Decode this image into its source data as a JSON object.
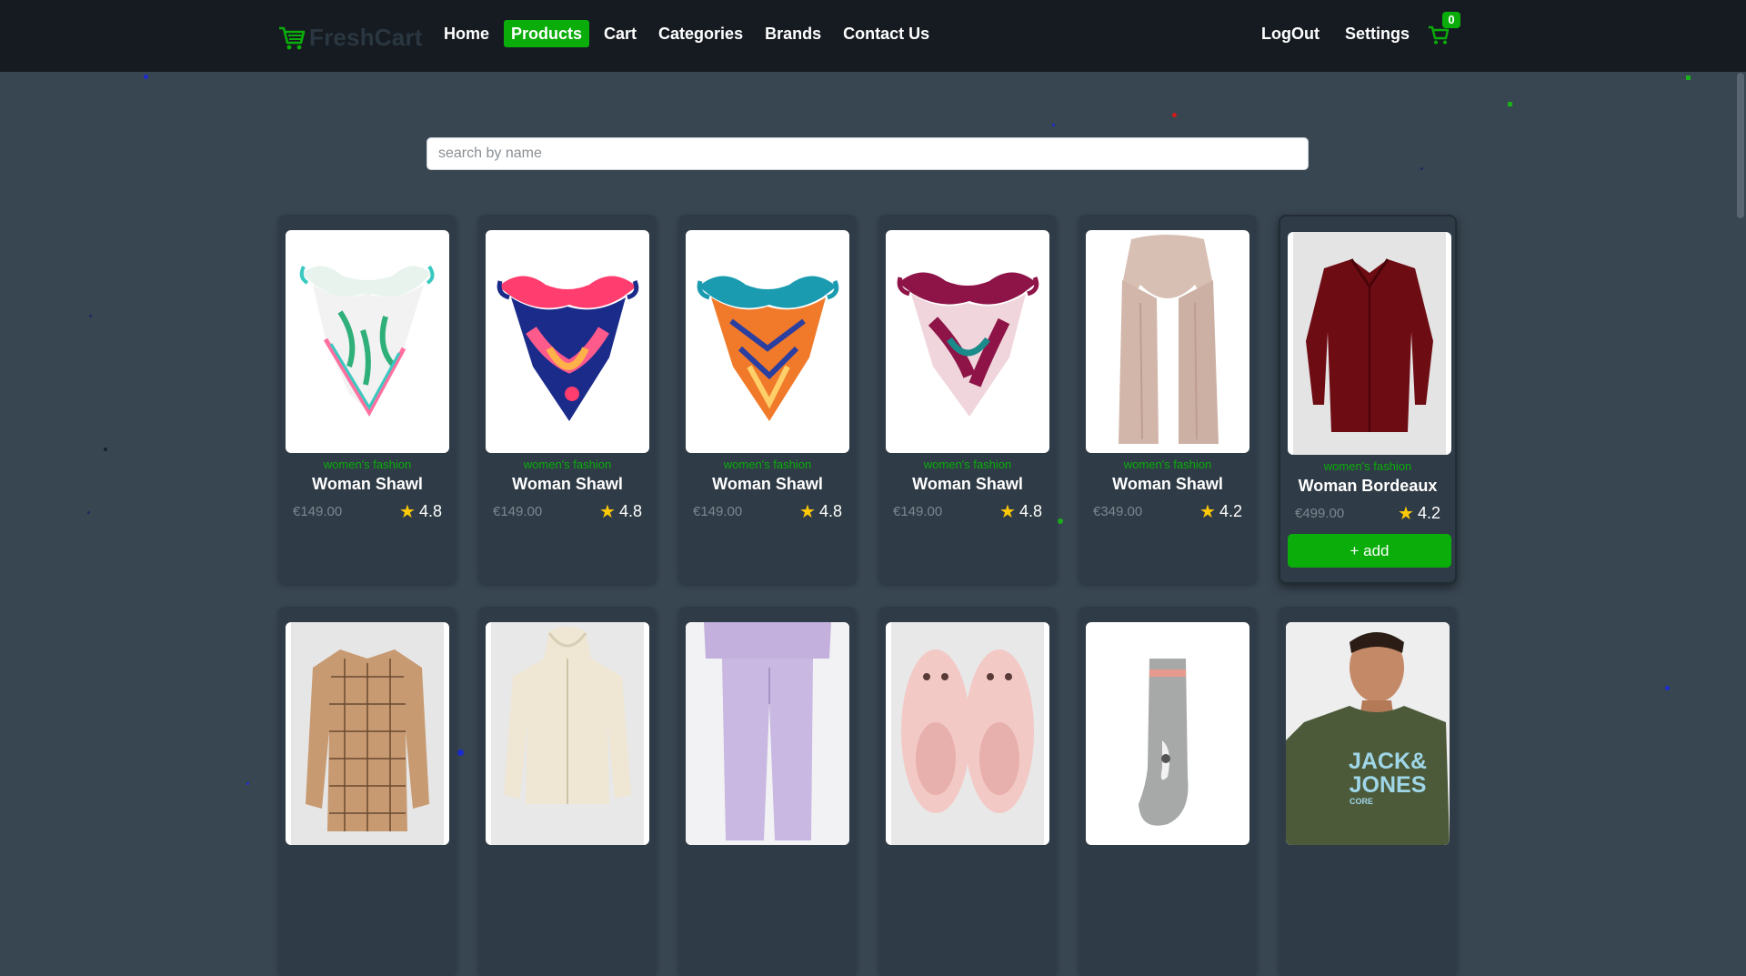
{
  "brand": {
    "name": "FreshCart",
    "icon": "cart-icon"
  },
  "nav": {
    "links": [
      "Home",
      "Products",
      "Cart",
      "Categories",
      "Brands",
      "Contact Us"
    ],
    "active": "Products",
    "right": [
      "LogOut",
      "Settings"
    ],
    "cart_count": "0"
  },
  "search": {
    "placeholder": "search by name",
    "value": ""
  },
  "products": [
    {
      "category": "women's fashion",
      "title": "Woman Shawl",
      "price": "€149.00",
      "rating": "4.8",
      "image": "shawl-white-pink-icon"
    },
    {
      "category": "women's fashion",
      "title": "Woman Shawl",
      "price": "€149.00",
      "rating": "4.8",
      "image": "shawl-navy-pink-icon"
    },
    {
      "category": "women's fashion",
      "title": "Woman Shawl",
      "price": "€149.00",
      "rating": "4.8",
      "image": "shawl-orange-teal-icon"
    },
    {
      "category": "women's fashion",
      "title": "Woman Shawl",
      "price": "€149.00",
      "rating": "4.8",
      "image": "shawl-burgundy-icon"
    },
    {
      "category": "women's fashion",
      "title": "Woman Shawl",
      "price": "€349.00",
      "rating": "4.2",
      "image": "scarf-beige-icon"
    },
    {
      "category": "women's fashion",
      "title": "Woman Bordeaux",
      "price": "€499.00",
      "rating": "4.2",
      "image": "blouse-bordeaux-icon",
      "add_label": "+ add"
    },
    {
      "image": "shirt-plaid-icon"
    },
    {
      "image": "hoodie-cream-icon"
    },
    {
      "image": "joggers-lilac-icon"
    },
    {
      "image": "slippers-pink-icon"
    },
    {
      "image": "sock-grey-icon"
    },
    {
      "image": "tshirt-jackjones-icon",
      "print": [
        "JACK&",
        "JONES",
        "CORE"
      ]
    }
  ],
  "colors": {
    "accent": "#0aad0a",
    "navbar": "#161b22",
    "page": "#384652",
    "card": "#2f3b46",
    "star": "#ffc908"
  }
}
